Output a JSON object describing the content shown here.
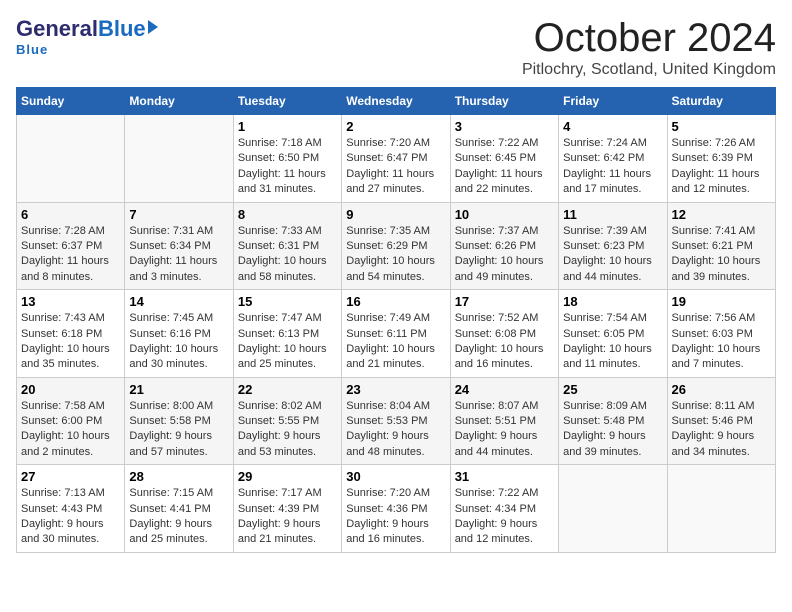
{
  "header": {
    "logo_general": "General",
    "logo_blue": "Blue",
    "month_title": "October 2024",
    "location": "Pitlochry, Scotland, United Kingdom"
  },
  "days_of_week": [
    "Sunday",
    "Monday",
    "Tuesday",
    "Wednesday",
    "Thursday",
    "Friday",
    "Saturday"
  ],
  "weeks": [
    [
      {
        "day": "",
        "content": ""
      },
      {
        "day": "",
        "content": ""
      },
      {
        "day": "1",
        "content": "Sunrise: 7:18 AM\nSunset: 6:50 PM\nDaylight: 11 hours and 31 minutes."
      },
      {
        "day": "2",
        "content": "Sunrise: 7:20 AM\nSunset: 6:47 PM\nDaylight: 11 hours and 27 minutes."
      },
      {
        "day": "3",
        "content": "Sunrise: 7:22 AM\nSunset: 6:45 PM\nDaylight: 11 hours and 22 minutes."
      },
      {
        "day": "4",
        "content": "Sunrise: 7:24 AM\nSunset: 6:42 PM\nDaylight: 11 hours and 17 minutes."
      },
      {
        "day": "5",
        "content": "Sunrise: 7:26 AM\nSunset: 6:39 PM\nDaylight: 11 hours and 12 minutes."
      }
    ],
    [
      {
        "day": "6",
        "content": "Sunrise: 7:28 AM\nSunset: 6:37 PM\nDaylight: 11 hours and 8 minutes."
      },
      {
        "day": "7",
        "content": "Sunrise: 7:31 AM\nSunset: 6:34 PM\nDaylight: 11 hours and 3 minutes."
      },
      {
        "day": "8",
        "content": "Sunrise: 7:33 AM\nSunset: 6:31 PM\nDaylight: 10 hours and 58 minutes."
      },
      {
        "day": "9",
        "content": "Sunrise: 7:35 AM\nSunset: 6:29 PM\nDaylight: 10 hours and 54 minutes."
      },
      {
        "day": "10",
        "content": "Sunrise: 7:37 AM\nSunset: 6:26 PM\nDaylight: 10 hours and 49 minutes."
      },
      {
        "day": "11",
        "content": "Sunrise: 7:39 AM\nSunset: 6:23 PM\nDaylight: 10 hours and 44 minutes."
      },
      {
        "day": "12",
        "content": "Sunrise: 7:41 AM\nSunset: 6:21 PM\nDaylight: 10 hours and 39 minutes."
      }
    ],
    [
      {
        "day": "13",
        "content": "Sunrise: 7:43 AM\nSunset: 6:18 PM\nDaylight: 10 hours and 35 minutes."
      },
      {
        "day": "14",
        "content": "Sunrise: 7:45 AM\nSunset: 6:16 PM\nDaylight: 10 hours and 30 minutes."
      },
      {
        "day": "15",
        "content": "Sunrise: 7:47 AM\nSunset: 6:13 PM\nDaylight: 10 hours and 25 minutes."
      },
      {
        "day": "16",
        "content": "Sunrise: 7:49 AM\nSunset: 6:11 PM\nDaylight: 10 hours and 21 minutes."
      },
      {
        "day": "17",
        "content": "Sunrise: 7:52 AM\nSunset: 6:08 PM\nDaylight: 10 hours and 16 minutes."
      },
      {
        "day": "18",
        "content": "Sunrise: 7:54 AM\nSunset: 6:05 PM\nDaylight: 10 hours and 11 minutes."
      },
      {
        "day": "19",
        "content": "Sunrise: 7:56 AM\nSunset: 6:03 PM\nDaylight: 10 hours and 7 minutes."
      }
    ],
    [
      {
        "day": "20",
        "content": "Sunrise: 7:58 AM\nSunset: 6:00 PM\nDaylight: 10 hours and 2 minutes."
      },
      {
        "day": "21",
        "content": "Sunrise: 8:00 AM\nSunset: 5:58 PM\nDaylight: 9 hours and 57 minutes."
      },
      {
        "day": "22",
        "content": "Sunrise: 8:02 AM\nSunset: 5:55 PM\nDaylight: 9 hours and 53 minutes."
      },
      {
        "day": "23",
        "content": "Sunrise: 8:04 AM\nSunset: 5:53 PM\nDaylight: 9 hours and 48 minutes."
      },
      {
        "day": "24",
        "content": "Sunrise: 8:07 AM\nSunset: 5:51 PM\nDaylight: 9 hours and 44 minutes."
      },
      {
        "day": "25",
        "content": "Sunrise: 8:09 AM\nSunset: 5:48 PM\nDaylight: 9 hours and 39 minutes."
      },
      {
        "day": "26",
        "content": "Sunrise: 8:11 AM\nSunset: 5:46 PM\nDaylight: 9 hours and 34 minutes."
      }
    ],
    [
      {
        "day": "27",
        "content": "Sunrise: 7:13 AM\nSunset: 4:43 PM\nDaylight: 9 hours and 30 minutes."
      },
      {
        "day": "28",
        "content": "Sunrise: 7:15 AM\nSunset: 4:41 PM\nDaylight: 9 hours and 25 minutes."
      },
      {
        "day": "29",
        "content": "Sunrise: 7:17 AM\nSunset: 4:39 PM\nDaylight: 9 hours and 21 minutes."
      },
      {
        "day": "30",
        "content": "Sunrise: 7:20 AM\nSunset: 4:36 PM\nDaylight: 9 hours and 16 minutes."
      },
      {
        "day": "31",
        "content": "Sunrise: 7:22 AM\nSunset: 4:34 PM\nDaylight: 9 hours and 12 minutes."
      },
      {
        "day": "",
        "content": ""
      },
      {
        "day": "",
        "content": ""
      }
    ]
  ]
}
